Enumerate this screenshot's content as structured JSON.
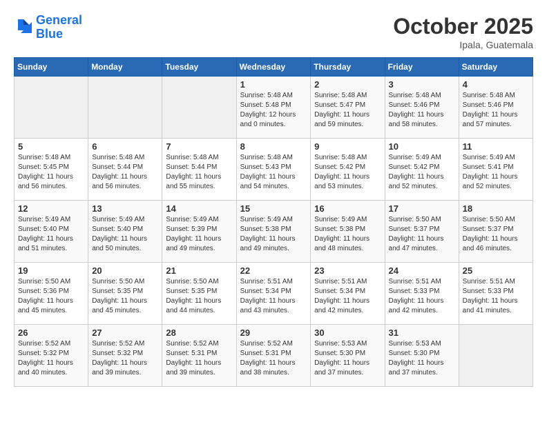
{
  "header": {
    "logo_line1": "General",
    "logo_line2": "Blue",
    "month_title": "October 2025",
    "location": "Ipala, Guatemala"
  },
  "days_of_week": [
    "Sunday",
    "Monday",
    "Tuesday",
    "Wednesday",
    "Thursday",
    "Friday",
    "Saturday"
  ],
  "weeks": [
    [
      {
        "day": "",
        "info": ""
      },
      {
        "day": "",
        "info": ""
      },
      {
        "day": "",
        "info": ""
      },
      {
        "day": "1",
        "info": "Sunrise: 5:48 AM\nSunset: 5:48 PM\nDaylight: 12 hours\nand 0 minutes."
      },
      {
        "day": "2",
        "info": "Sunrise: 5:48 AM\nSunset: 5:47 PM\nDaylight: 11 hours\nand 59 minutes."
      },
      {
        "day": "3",
        "info": "Sunrise: 5:48 AM\nSunset: 5:46 PM\nDaylight: 11 hours\nand 58 minutes."
      },
      {
        "day": "4",
        "info": "Sunrise: 5:48 AM\nSunset: 5:46 PM\nDaylight: 11 hours\nand 57 minutes."
      }
    ],
    [
      {
        "day": "5",
        "info": "Sunrise: 5:48 AM\nSunset: 5:45 PM\nDaylight: 11 hours\nand 56 minutes."
      },
      {
        "day": "6",
        "info": "Sunrise: 5:48 AM\nSunset: 5:44 PM\nDaylight: 11 hours\nand 56 minutes."
      },
      {
        "day": "7",
        "info": "Sunrise: 5:48 AM\nSunset: 5:44 PM\nDaylight: 11 hours\nand 55 minutes."
      },
      {
        "day": "8",
        "info": "Sunrise: 5:48 AM\nSunset: 5:43 PM\nDaylight: 11 hours\nand 54 minutes."
      },
      {
        "day": "9",
        "info": "Sunrise: 5:48 AM\nSunset: 5:42 PM\nDaylight: 11 hours\nand 53 minutes."
      },
      {
        "day": "10",
        "info": "Sunrise: 5:49 AM\nSunset: 5:42 PM\nDaylight: 11 hours\nand 52 minutes."
      },
      {
        "day": "11",
        "info": "Sunrise: 5:49 AM\nSunset: 5:41 PM\nDaylight: 11 hours\nand 52 minutes."
      }
    ],
    [
      {
        "day": "12",
        "info": "Sunrise: 5:49 AM\nSunset: 5:40 PM\nDaylight: 11 hours\nand 51 minutes."
      },
      {
        "day": "13",
        "info": "Sunrise: 5:49 AM\nSunset: 5:40 PM\nDaylight: 11 hours\nand 50 minutes."
      },
      {
        "day": "14",
        "info": "Sunrise: 5:49 AM\nSunset: 5:39 PM\nDaylight: 11 hours\nand 49 minutes."
      },
      {
        "day": "15",
        "info": "Sunrise: 5:49 AM\nSunset: 5:38 PM\nDaylight: 11 hours\nand 49 minutes."
      },
      {
        "day": "16",
        "info": "Sunrise: 5:49 AM\nSunset: 5:38 PM\nDaylight: 11 hours\nand 48 minutes."
      },
      {
        "day": "17",
        "info": "Sunrise: 5:50 AM\nSunset: 5:37 PM\nDaylight: 11 hours\nand 47 minutes."
      },
      {
        "day": "18",
        "info": "Sunrise: 5:50 AM\nSunset: 5:37 PM\nDaylight: 11 hours\nand 46 minutes."
      }
    ],
    [
      {
        "day": "19",
        "info": "Sunrise: 5:50 AM\nSunset: 5:36 PM\nDaylight: 11 hours\nand 45 minutes."
      },
      {
        "day": "20",
        "info": "Sunrise: 5:50 AM\nSunset: 5:35 PM\nDaylight: 11 hours\nand 45 minutes."
      },
      {
        "day": "21",
        "info": "Sunrise: 5:50 AM\nSunset: 5:35 PM\nDaylight: 11 hours\nand 44 minutes."
      },
      {
        "day": "22",
        "info": "Sunrise: 5:51 AM\nSunset: 5:34 PM\nDaylight: 11 hours\nand 43 minutes."
      },
      {
        "day": "23",
        "info": "Sunrise: 5:51 AM\nSunset: 5:34 PM\nDaylight: 11 hours\nand 42 minutes."
      },
      {
        "day": "24",
        "info": "Sunrise: 5:51 AM\nSunset: 5:33 PM\nDaylight: 11 hours\nand 42 minutes."
      },
      {
        "day": "25",
        "info": "Sunrise: 5:51 AM\nSunset: 5:33 PM\nDaylight: 11 hours\nand 41 minutes."
      }
    ],
    [
      {
        "day": "26",
        "info": "Sunrise: 5:52 AM\nSunset: 5:32 PM\nDaylight: 11 hours\nand 40 minutes."
      },
      {
        "day": "27",
        "info": "Sunrise: 5:52 AM\nSunset: 5:32 PM\nDaylight: 11 hours\nand 39 minutes."
      },
      {
        "day": "28",
        "info": "Sunrise: 5:52 AM\nSunset: 5:31 PM\nDaylight: 11 hours\nand 39 minutes."
      },
      {
        "day": "29",
        "info": "Sunrise: 5:52 AM\nSunset: 5:31 PM\nDaylight: 11 hours\nand 38 minutes."
      },
      {
        "day": "30",
        "info": "Sunrise: 5:53 AM\nSunset: 5:30 PM\nDaylight: 11 hours\nand 37 minutes."
      },
      {
        "day": "31",
        "info": "Sunrise: 5:53 AM\nSunset: 5:30 PM\nDaylight: 11 hours\nand 37 minutes."
      },
      {
        "day": "",
        "info": ""
      }
    ]
  ]
}
